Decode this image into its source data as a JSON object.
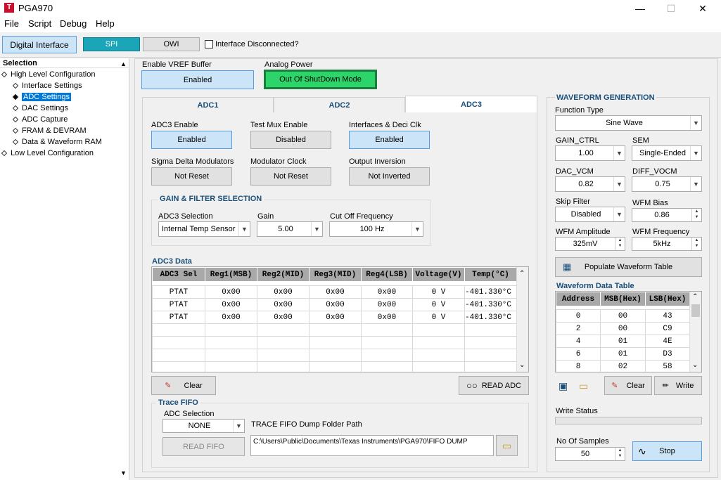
{
  "window": {
    "title": "PGA970",
    "app_icon": "T",
    "minimize": "—",
    "maximize": "☐",
    "close": "✕"
  },
  "menu": {
    "file": "File",
    "script": "Script",
    "debug": "Debug",
    "help": "Help"
  },
  "toolbar": {
    "digital_interface": "Digital Interface",
    "spi": "SPI",
    "owi": "OWI",
    "interface_disconnected": "Interface Disconnected?"
  },
  "tree": {
    "header": "Selection",
    "items": [
      "High Level Configuration",
      "Interface Settings",
      "ADC Settings",
      "DAC Settings",
      "ADC Capture",
      "FRAM & DEVRAM",
      "Data & Waveform RAM",
      "Low Level Configuration"
    ]
  },
  "vref": {
    "label": "Enable VREF Buffer",
    "value": "Enabled"
  },
  "analog_power": {
    "label": "Analog Power",
    "value": "Out Of ShutDown Mode"
  },
  "tabs": [
    "ADC1",
    "ADC2",
    "ADC3"
  ],
  "adc3": {
    "enable_label": "ADC3 Enable",
    "enable_value": "Enabled",
    "testmux_label": "Test Mux Enable",
    "testmux_value": "Disabled",
    "interfaces_label": "Interfaces & Deci Clk",
    "interfaces_value": "Enabled",
    "sdm_label": "Sigma Delta Modulators",
    "sdm_value": "Not Reset",
    "modclk_label": "Modulator Clock",
    "modclk_value": "Not Reset",
    "outinv_label": "Output Inversion",
    "outinv_value": "Not Inverted"
  },
  "gain_filter": {
    "title": "GAIN & FILTER SELECTION",
    "sel_label": "ADC3 Selection",
    "sel_value": "Internal Temp Sensor",
    "gain_label": "Gain",
    "gain_value": "5.00",
    "cutoff_label": "Cut Off Frequency",
    "cutoff_value": "100 Hz"
  },
  "adc_data": {
    "title": "ADC3 Data",
    "columns": [
      "ADC3 Sel",
      "Reg1(MSB)",
      "Reg2(MID)",
      "Reg3(MID)",
      "Reg4(LSB)",
      "Voltage(V)",
      "Temp(°C)"
    ],
    "rows": [
      [
        "PTAT",
        "0x00",
        "0x00",
        "0x00",
        "0x00",
        "0 V",
        "-401.330°C"
      ],
      [
        "PTAT",
        "0x00",
        "0x00",
        "0x00",
        "0x00",
        "0 V",
        "-401.330°C"
      ],
      [
        "PTAT",
        "0x00",
        "0x00",
        "0x00",
        "0x00",
        "0 V",
        "-401.330°C"
      ]
    ],
    "clear": "Clear",
    "read_adc": "READ ADC"
  },
  "trace": {
    "title": "Trace FIFO",
    "adc_sel_label": "ADC Selection",
    "adc_sel_value": "NONE",
    "read_fifo": "READ FIFO",
    "path_label": "TRACE FIFO Dump Folder Path",
    "path_value": "C:\\Users\\Public\\Documents\\Texas Instruments\\PGA970\\FIFO DUMP"
  },
  "waveform": {
    "title": "WAVEFORM GENERATION",
    "func_label": "Function Type",
    "func_value": "Sine Wave",
    "gain_ctrl_label": "GAIN_CTRL",
    "gain_ctrl_value": "1.00",
    "sem_label": "SEM",
    "sem_value": "Single-Ended",
    "dac_vcm_label": "DAC_VCM",
    "dac_vcm_value": "0.82",
    "diff_vocm_label": "DIFF_VOCM",
    "diff_vocm_value": "0.75",
    "skip_label": "Skip Filter",
    "skip_value": "Disabled",
    "bias_label": "WFM Bias",
    "bias_value": "0.86",
    "amp_label": "WFM Amplitude",
    "amp_value": "325mV",
    "freq_label": "WFM Frequency",
    "freq_value": "5kHz",
    "populate": "Populate Waveform Table",
    "table_title": "Waveform Data Table",
    "table_columns": [
      "Address",
      "MSB(Hex)",
      "LSB(Hex)"
    ],
    "table_rows": [
      [
        "0",
        "00",
        "43"
      ],
      [
        "2",
        "00",
        "C9"
      ],
      [
        "4",
        "01",
        "4E"
      ],
      [
        "6",
        "01",
        "D3"
      ],
      [
        "8",
        "02",
        "58"
      ]
    ],
    "clear": "Clear",
    "write": "Write",
    "write_status_label": "Write Status",
    "samples_label": "No Of  Samples",
    "samples_value": "50",
    "stop": "Stop"
  }
}
